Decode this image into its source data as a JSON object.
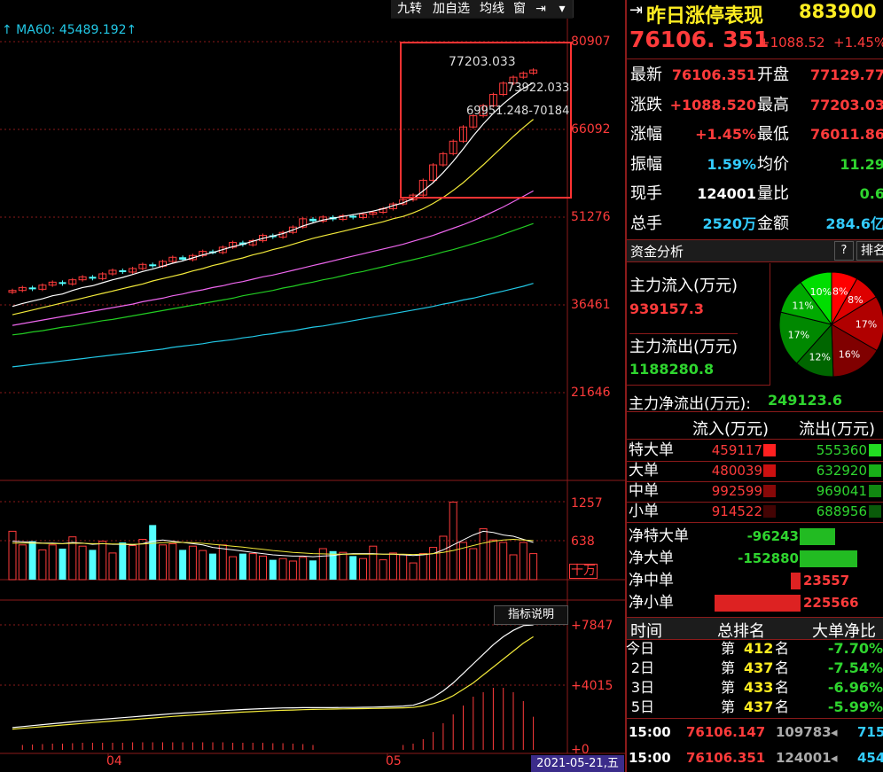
{
  "toolbar": {
    "buttons": [
      "九转",
      "加自选",
      "均线",
      "窗"
    ],
    "expand_icon": "expand-arrow-icon",
    "menu_icon": "caret-down-icon"
  },
  "ma_label": "↑ MA60: 45489.192↑",
  "price_axis": [
    "80907",
    "66092",
    "51276",
    "36461",
    "21646"
  ],
  "volume_axis": [
    "1257",
    "638",
    "十万"
  ],
  "indicator_axis": [
    "+7847",
    "+4015",
    "+0"
  ],
  "indicator_button": "指标说明",
  "date_axis": [
    "04",
    "05"
  ],
  "cursor_date": "2021-05-21,五",
  "annotations": {
    "high": "77203.033",
    "close": "73922.033",
    "range": "69951.248-70184"
  },
  "colors": {
    "up": "#ff3b3b",
    "down": "#54ffff",
    "ma5": "#ffffff",
    "ma10": "#f2e93a",
    "ma20": "#ee66ee",
    "ma30": "#22cc22",
    "ma60": "#22c8e6",
    "highlight_box": "#ff3333"
  },
  "chart_data": [
    {
      "type": "candlestick",
      "title": "",
      "ylim": [
        21646,
        80907
      ],
      "series": [
        {
          "name": "K",
          "close": [
            38900,
            39400,
            39100,
            39800,
            40300,
            40000,
            40700,
            41200,
            40900,
            41700,
            42300,
            42000,
            42600,
            43300,
            43000,
            43800,
            44500,
            44100,
            44800,
            45500,
            45300,
            46200,
            47000,
            46600,
            47300,
            48200,
            47900,
            48700,
            49600,
            51000,
            50600,
            51300,
            50900,
            51500,
            51200,
            51800,
            52100,
            52700,
            53500,
            54200,
            55000,
            57500,
            60100,
            62000,
            64100,
            66500,
            68400,
            70100,
            72000,
            73900,
            74900,
            75600,
            76106
          ]
        },
        {
          "name": "MA5",
          "values": [
            36200,
            36700,
            37100,
            37500,
            38000,
            38300,
            38900,
            39400,
            39700,
            40200,
            40700,
            41100,
            41600,
            42100,
            42500,
            43000,
            43500,
            43900,
            44400,
            44900,
            45300,
            45800,
            46300,
            46700,
            47200,
            47700,
            48100,
            48500,
            49100,
            49800,
            50300,
            50800,
            51100,
            51400,
            51700,
            52000,
            52300,
            52700,
            53200,
            53700,
            54400,
            55700,
            57100,
            58800,
            60700,
            62800,
            65000,
            67000,
            68800,
            70400,
            71800,
            73000,
            74000
          ]
        },
        {
          "name": "MA10",
          "values": [
            34800,
            35200,
            35600,
            36000,
            36400,
            36800,
            37200,
            37600,
            38000,
            38400,
            38800,
            39200,
            39600,
            40000,
            40500,
            40900,
            41300,
            41700,
            42200,
            42600,
            43100,
            43500,
            44000,
            44400,
            44900,
            45300,
            45800,
            46200,
            46700,
            47200,
            47700,
            48100,
            48500,
            48900,
            49300,
            49700,
            50100,
            50500,
            51000,
            51400,
            52000,
            52700,
            53600,
            54600,
            55800,
            57100,
            58600,
            60100,
            61700,
            63300,
            64900,
            66400,
            67800
          ]
        },
        {
          "name": "MA20",
          "values": [
            33000,
            33300,
            33600,
            33900,
            34200,
            34500,
            34800,
            35100,
            35400,
            35700,
            36000,
            36300,
            36600,
            37000,
            37300,
            37600,
            38000,
            38300,
            38700,
            39000,
            39400,
            39700,
            40100,
            40400,
            40800,
            41200,
            41500,
            41900,
            42300,
            42700,
            43100,
            43500,
            43900,
            44300,
            44700,
            45100,
            45500,
            45900,
            46300,
            46700,
            47200,
            47700,
            48200,
            48800,
            49400,
            50000,
            50700,
            51400,
            52200,
            53000,
            53900,
            54800,
            55700
          ]
        },
        {
          "name": "MA30",
          "values": [
            31400,
            31600,
            31900,
            32100,
            32400,
            32700,
            32900,
            33200,
            33500,
            33800,
            34000,
            34300,
            34600,
            34900,
            35200,
            35500,
            35800,
            36100,
            36400,
            36700,
            37000,
            37300,
            37600,
            38000,
            38300,
            38600,
            38900,
            39300,
            39600,
            40000,
            40300,
            40700,
            41000,
            41400,
            41800,
            42100,
            42500,
            42900,
            43300,
            43700,
            44100,
            44500,
            44900,
            45400,
            45800,
            46300,
            46800,
            47300,
            47800,
            48400,
            49000,
            49600,
            50200
          ]
        },
        {
          "name": "MA60",
          "values": [
            26000,
            26200,
            26400,
            26600,
            26800,
            27000,
            27200,
            27400,
            27600,
            27800,
            28000,
            28200,
            28400,
            28600,
            28800,
            29000,
            29300,
            29500,
            29700,
            29900,
            30200,
            30400,
            30600,
            30900,
            31100,
            31400,
            31600,
            31900,
            32100,
            32400,
            32700,
            32900,
            33200,
            33500,
            33800,
            34100,
            34400,
            34700,
            35000,
            35300,
            35600,
            35900,
            36200,
            36600,
            36900,
            37300,
            37600,
            38000,
            38400,
            38800,
            39200,
            39600,
            40100
          ]
        }
      ]
    },
    {
      "type": "bar",
      "title": "",
      "ylim": [
        0,
        1257
      ],
      "series": [
        {
          "name": "volume",
          "values": [
            780,
            560,
            620,
            480,
            560,
            500,
            690,
            540,
            480,
            620,
            430,
            600,
            550,
            650,
            880,
            560,
            580,
            480,
            540,
            470,
            420,
            560,
            370,
            420,
            420,
            380,
            320,
            340,
            300,
            360,
            310,
            500,
            460,
            440,
            380,
            340,
            540,
            320,
            430,
            400,
            270,
            420,
            520,
            700,
            1250,
            600,
            500,
            820,
            640,
            600,
            400,
            600,
            420
          ]
        },
        {
          "name": "MA5",
          "values": [
            620,
            610,
            600,
            590,
            590,
            580,
            600,
            590,
            570,
            580,
            570,
            570,
            560,
            580,
            620,
            640,
            620,
            600,
            580,
            560,
            520,
            500,
            480,
            460,
            440,
            420,
            400,
            390,
            380,
            380,
            370,
            380,
            390,
            410,
            420,
            420,
            420,
            410,
            410,
            400,
            390,
            400,
            420,
            480,
            560,
            640,
            720,
            780,
            760,
            720,
            700,
            650,
            600
          ]
        },
        {
          "name": "MA10",
          "values": [
            590,
            590,
            590,
            585,
            580,
            580,
            585,
            585,
            580,
            580,
            575,
            575,
            570,
            575,
            585,
            595,
            600,
            600,
            595,
            585,
            570,
            555,
            540,
            525,
            505,
            490,
            470,
            455,
            440,
            430,
            420,
            415,
            410,
            410,
            410,
            410,
            410,
            410,
            410,
            410,
            405,
            410,
            420,
            440,
            470,
            510,
            550,
            590,
            620,
            640,
            650,
            640,
            630
          ]
        }
      ]
    },
    {
      "type": "line",
      "title": "",
      "ylim": [
        0,
        7847
      ],
      "series": [
        {
          "name": "line1",
          "values": [
            1400,
            1460,
            1520,
            1580,
            1640,
            1700,
            1760,
            1820,
            1870,
            1920,
            1970,
            2020,
            2070,
            2120,
            2170,
            2220,
            2270,
            2310,
            2350,
            2390,
            2430,
            2470,
            2500,
            2530,
            2560,
            2590,
            2610,
            2630,
            2640,
            2650,
            2650,
            2650,
            2650,
            2660,
            2660,
            2670,
            2680,
            2700,
            2720,
            2750,
            2800,
            3000,
            3300,
            3700,
            4200,
            4800,
            5400,
            6000,
            6600,
            7100,
            7500,
            7800,
            7847
          ]
        },
        {
          "name": "line2",
          "values": [
            1300,
            1350,
            1400,
            1450,
            1500,
            1560,
            1610,
            1660,
            1710,
            1760,
            1810,
            1860,
            1900,
            1950,
            2000,
            2050,
            2100,
            2140,
            2180,
            2220,
            2260,
            2300,
            2340,
            2370,
            2400,
            2430,
            2460,
            2480,
            2500,
            2520,
            2540,
            2550,
            2560,
            2570,
            2580,
            2590,
            2600,
            2610,
            2620,
            2640,
            2660,
            2760,
            2900,
            3100,
            3400,
            3800,
            4200,
            4700,
            5200,
            5700,
            6200,
            6700,
            7100
          ]
        }
      ]
    }
  ],
  "quote": {
    "title": "昨日涨停表现",
    "code": "883900",
    "price": "76106. 351",
    "change": "+1088.52",
    "change_pct": "+1.45%",
    "rows": [
      {
        "l1": "最新",
        "v1": "76106.351",
        "l2": "开盘",
        "v2": "77129.77"
      },
      {
        "l1": "涨跌",
        "v1": "+1088.520",
        "l2": "最高",
        "v2": "77203.03"
      },
      {
        "l1": "涨幅",
        "v1": "+1.45%",
        "l2": "最低",
        "v2": "76011.86"
      },
      {
        "l1": "振幅",
        "v1": "1.59%",
        "l2": "均价",
        "v2": "11.29"
      },
      {
        "l1": "现手",
        "v1": "124001",
        "l2": "量比",
        "v2": "0.6"
      },
      {
        "l1": "总手",
        "v1": "2520万",
        "l2": "金额",
        "v2": "284.6亿"
      }
    ]
  },
  "fund": {
    "header": "资金分析",
    "help": "?",
    "rank_button": "排名",
    "inflow_label": "主力流入(万元)",
    "inflow_value": "939157.3",
    "outflow_label": "主力流出(万元)",
    "outflow_value": "1188280.8",
    "net_label": "主力净流出(万元):",
    "net_value": "249123.6",
    "pie": [
      {
        "label": "8%",
        "value": 8,
        "color": "#ff0000"
      },
      {
        "label": "8%",
        "value": 8,
        "color": "#dd0000"
      },
      {
        "label": "17%",
        "value": 17,
        "color": "#b00000"
      },
      {
        "label": "16%",
        "value": 16,
        "color": "#800000"
      },
      {
        "label": "12%",
        "value": 12,
        "color": "#006600"
      },
      {
        "label": "17%",
        "value": 17,
        "color": "#008800"
      },
      {
        "label": "11%",
        "value": 11,
        "color": "#00aa00"
      },
      {
        "label": "10%",
        "value": 10,
        "color": "#00dd00"
      }
    ],
    "col_in": "流入(万元)",
    "col_out": "流出(万元)",
    "orders": [
      {
        "label": "特大单",
        "in": "459117",
        "out": "555360",
        "cin": "#ff2020",
        "cout": "#22dd22"
      },
      {
        "label": "大单",
        "in": "480039",
        "out": "632920",
        "cin": "#cc1010",
        "cout": "#18b018"
      },
      {
        "label": "中单",
        "in": "992599",
        "out": "969041",
        "cin": "#880808",
        "cout": "#118811"
      },
      {
        "label": "小单",
        "in": "914522",
        "out": "688956",
        "cin": "#440404",
        "cout": "#0a5a0a"
      }
    ],
    "net": [
      {
        "label": "净特大单",
        "value": "-96243",
        "ratio": 0.19,
        "sign": "neg"
      },
      {
        "label": "净大单",
        "value": "-152880",
        "ratio": 0.31,
        "sign": "neg"
      },
      {
        "label": "净中单",
        "value": "23557",
        "ratio": 0.05,
        "sign": "pos"
      },
      {
        "label": "净小单",
        "value": "225566",
        "ratio": 0.46,
        "sign": "pos"
      }
    ]
  },
  "ranking": {
    "headers": [
      "时间",
      "总排名",
      "大单净比"
    ],
    "rows": [
      {
        "day": "今日",
        "pre": "第",
        "rank": "412",
        "suf": "名",
        "pct": "-7.70%"
      },
      {
        "day": "2日",
        "pre": "第",
        "rank": "437",
        "suf": "名",
        "pct": "-7.54%"
      },
      {
        "day": "3日",
        "pre": "第",
        "rank": "433",
        "suf": "名",
        "pct": "-6.96%"
      },
      {
        "day": "5日",
        "pre": "第",
        "rank": "437",
        "suf": "名",
        "pct": "-5.99%"
      }
    ]
  },
  "ticks": [
    {
      "time": "15:00",
      "price": "76106.147",
      "vol": "109783",
      "num": "715"
    },
    {
      "time": "15:00",
      "price": "76106.351",
      "vol": "124001",
      "num": "454"
    }
  ]
}
